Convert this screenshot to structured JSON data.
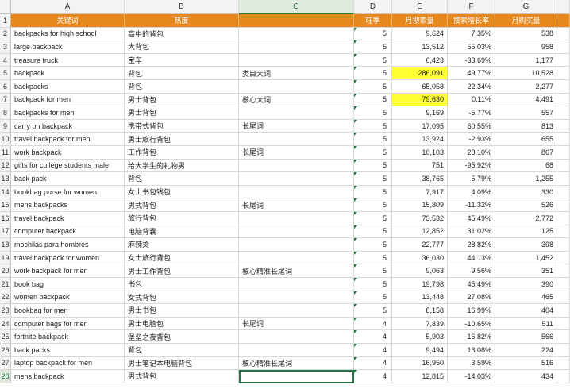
{
  "column_letters": [
    "A",
    "B",
    "C",
    "D",
    "E",
    "F",
    "G"
  ],
  "header": {
    "row_num": "1",
    "a": "关键词",
    "b": "热度",
    "c": "",
    "d": "旺季",
    "e": "月搜索量",
    "f": "搜索增长率",
    "g": "月购买量"
  },
  "rows": [
    {
      "n": "2",
      "a": "backpacks for high school",
      "b": "高中的背包",
      "c": "",
      "d": "5",
      "e": "9,624",
      "f": "7.35%",
      "g": "538",
      "hl": false
    },
    {
      "n": "3",
      "a": "large backpack",
      "b": "大背包",
      "c": "",
      "d": "5",
      "e": "13,512",
      "f": "55.03%",
      "g": "958",
      "hl": false
    },
    {
      "n": "4",
      "a": "treasure truck",
      "b": "宝车",
      "c": "",
      "d": "5",
      "e": "6,423",
      "f": "-33.69%",
      "g": "1,177",
      "hl": false
    },
    {
      "n": "5",
      "a": "backpack",
      "b": "背包",
      "c": "类目大词",
      "d": "5",
      "e": "286,091",
      "f": "49.77%",
      "g": "10,528",
      "hl": true
    },
    {
      "n": "6",
      "a": "backpacks",
      "b": "背包",
      "c": "",
      "d": "5",
      "e": "65,058",
      "f": "22.34%",
      "g": "2,277",
      "hl": false
    },
    {
      "n": "7",
      "a": "backpack for men",
      "b": "男士背包",
      "c": "核心大词",
      "d": "5",
      "e": "79,630",
      "f": "0.11%",
      "g": "4,491",
      "hl": true
    },
    {
      "n": "8",
      "a": "backpacks for men",
      "b": "男士背包",
      "c": "",
      "d": "5",
      "e": "9,169",
      "f": "-5.77%",
      "g": "557",
      "hl": false
    },
    {
      "n": "9",
      "a": "carry on backpack",
      "b": "携带式背包",
      "c": "长尾词",
      "d": "5",
      "e": "17,095",
      "f": "60.55%",
      "g": "813",
      "hl": false
    },
    {
      "n": "10",
      "a": "travel backpack for men",
      "b": "男士旅行背包",
      "c": "",
      "d": "5",
      "e": "13,924",
      "f": "-2.93%",
      "g": "655",
      "hl": false
    },
    {
      "n": "11",
      "a": "work backpack",
      "b": "工作背包",
      "c": "长尾词",
      "d": "5",
      "e": "10,103",
      "f": "28.10%",
      "g": "867",
      "hl": false
    },
    {
      "n": "12",
      "a": "gifts for college students male",
      "b": "给大学生的礼物男",
      "c": "",
      "d": "5",
      "e": "751",
      "f": "-95.92%",
      "g": "68",
      "hl": false
    },
    {
      "n": "13",
      "a": "back pack",
      "b": "背包",
      "c": "",
      "d": "5",
      "e": "38,765",
      "f": "5.79%",
      "g": "1,255",
      "hl": false
    },
    {
      "n": "14",
      "a": "bookbag purse for women",
      "b": "女士书包钱包",
      "c": "",
      "d": "5",
      "e": "7,917",
      "f": "4.09%",
      "g": "330",
      "hl": false
    },
    {
      "n": "15",
      "a": "mens backpacks",
      "b": "男式背包",
      "c": "长尾词",
      "d": "5",
      "e": "15,809",
      "f": "-11.32%",
      "g": "526",
      "hl": false
    },
    {
      "n": "16",
      "a": "travel backpack",
      "b": "旅行背包",
      "c": "",
      "d": "5",
      "e": "73,532",
      "f": "45.49%",
      "g": "2,772",
      "hl": false
    },
    {
      "n": "17",
      "a": "computer backpack",
      "b": "电脑背囊",
      "c": "",
      "d": "5",
      "e": "12,852",
      "f": "31.02%",
      "g": "125",
      "hl": false
    },
    {
      "n": "18",
      "a": "mochilas para hombres",
      "b": "麻辣烫",
      "c": "",
      "d": "5",
      "e": "22,777",
      "f": "28.82%",
      "g": "398",
      "hl": false
    },
    {
      "n": "19",
      "a": "travel backpack for women",
      "b": "女士旅行背包",
      "c": "",
      "d": "5",
      "e": "36,030",
      "f": "44.13%",
      "g": "1,452",
      "hl": false
    },
    {
      "n": "20",
      "a": "work backpack for men",
      "b": "男士工作背包",
      "c": "核心精准长尾词",
      "d": "5",
      "e": "9,063",
      "f": "9.56%",
      "g": "351",
      "hl": false
    },
    {
      "n": "21",
      "a": "book bag",
      "b": "书包",
      "c": "",
      "d": "5",
      "e": "19,798",
      "f": "45.49%",
      "g": "390",
      "hl": false
    },
    {
      "n": "22",
      "a": "women backpack",
      "b": "女式背包",
      "c": "",
      "d": "5",
      "e": "13,448",
      "f": "27.08%",
      "g": "465",
      "hl": false
    },
    {
      "n": "23",
      "a": "bookbag for men",
      "b": "男士书包",
      "c": "",
      "d": "5",
      "e": "8,158",
      "f": "16.99%",
      "g": "404",
      "hl": false
    },
    {
      "n": "24",
      "a": "computer bags for men",
      "b": "男士电脑包",
      "c": "长尾词",
      "d": "4",
      "e": "7,839",
      "f": "-10.65%",
      "g": "511",
      "hl": false
    },
    {
      "n": "25",
      "a": "fortnite backpack",
      "b": "堡垒之夜背包",
      "c": "",
      "d": "4",
      "e": "5,903",
      "f": "-16.82%",
      "g": "566",
      "hl": false
    },
    {
      "n": "26",
      "a": "back packs",
      "b": "背包",
      "c": "",
      "d": "4",
      "e": "9,494",
      "f": "13.08%",
      "g": "224",
      "hl": false
    },
    {
      "n": "27",
      "a": "laptop backpack for men",
      "b": "男士笔记本电脑背包",
      "c": "核心精准长尾词",
      "d": "4",
      "e": "16,950",
      "f": "3.59%",
      "g": "516",
      "hl": false
    },
    {
      "n": "28",
      "a": "mens backpack",
      "b": "男式背包",
      "c": "",
      "d": "4",
      "e": "12,815",
      "f": "-14.03%",
      "g": "434",
      "hl": false
    }
  ],
  "colors": {
    "header_fill": "#e5891f",
    "highlight": "#ffff33",
    "selection": "#217346"
  }
}
